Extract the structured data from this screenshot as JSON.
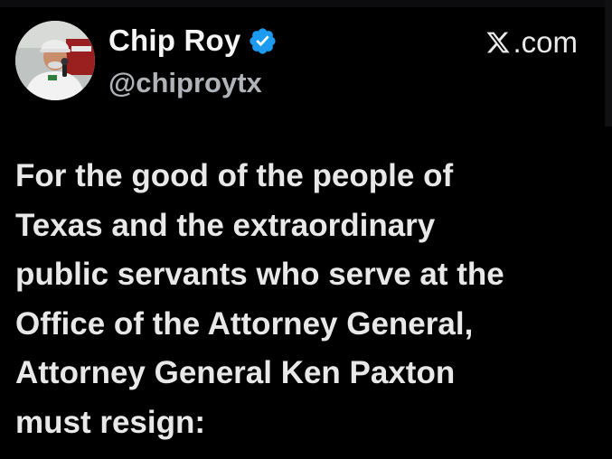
{
  "author": {
    "name": "Chip Roy",
    "handle": "@chiproytx",
    "verified": true
  },
  "site": {
    "label": ".com",
    "icon": "x-logo-icon"
  },
  "tweet": {
    "lines": [
      "For the good of the people of",
      "Texas and the extraordinary",
      "public servants who serve at the",
      "Office of the Attorney General,",
      "Attorney General Ken Paxton",
      "must resign:"
    ]
  },
  "colors": {
    "background": "#000000",
    "text": "#e7e9ea",
    "handle": "#b0b3b8",
    "verified_badge": "#1d9bf0"
  }
}
